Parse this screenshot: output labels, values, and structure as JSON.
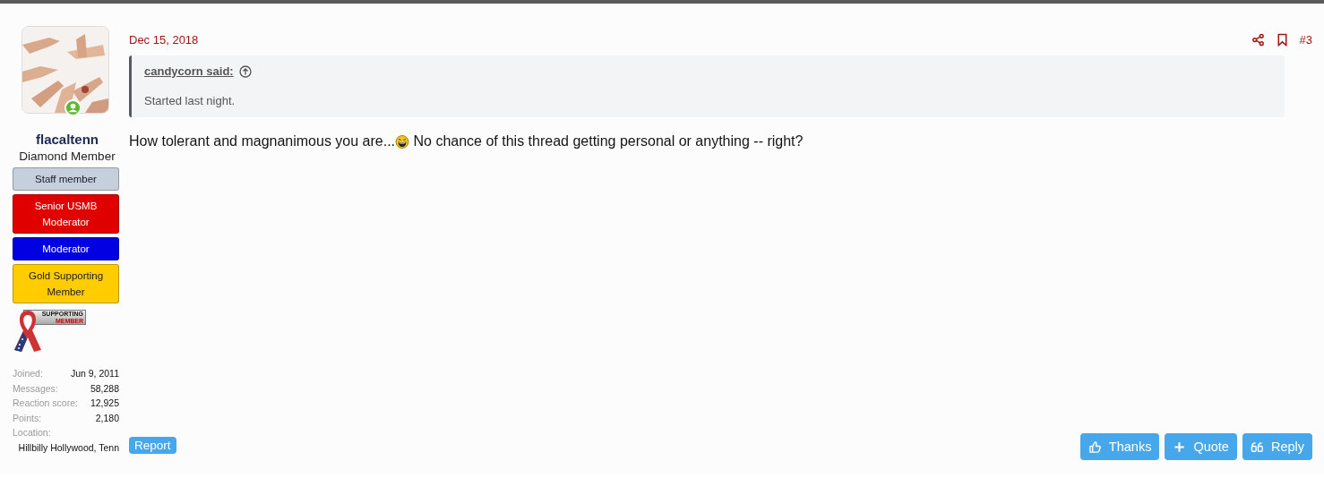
{
  "user": {
    "name": "flacaltenn",
    "title": "Diamond Member",
    "online": true,
    "banners": [
      {
        "label": "Staff member",
        "color": "#c5d0dc"
      },
      {
        "label": "Senior USMB Moderator",
        "color": "#e00000"
      },
      {
        "label": "Moderator",
        "color": "#0000e0"
      },
      {
        "label": "Gold Supporting Member",
        "color": "#ffcc00"
      }
    ],
    "ribbon_badge": {
      "top": "SUPPORTING",
      "bottom": "MEMBER"
    },
    "stats": [
      {
        "label": "Joined:",
        "value": "Jun 9, 2011"
      },
      {
        "label": "Messages:",
        "value": "58,288"
      },
      {
        "label": "Reaction score:",
        "value": "12,925"
      },
      {
        "label": "Points:",
        "value": "2,180"
      },
      {
        "label": "Location:",
        "value": "Hillbilly Hollywood, Tenn"
      }
    ]
  },
  "post": {
    "date": "Dec 15, 2018",
    "number": "#3",
    "quote": {
      "author": "candycorn said:",
      "text": "Started last night."
    },
    "body_before": "How tolerant and magnanimous you are...",
    "body_after": " No chance of this thread getting personal or anything -- right?",
    "report": "Report",
    "actions": [
      {
        "kind": "thanks",
        "label": "Thanks"
      },
      {
        "kind": "quote",
        "label": "Quote"
      },
      {
        "kind": "reply",
        "label": "Reply"
      }
    ]
  }
}
